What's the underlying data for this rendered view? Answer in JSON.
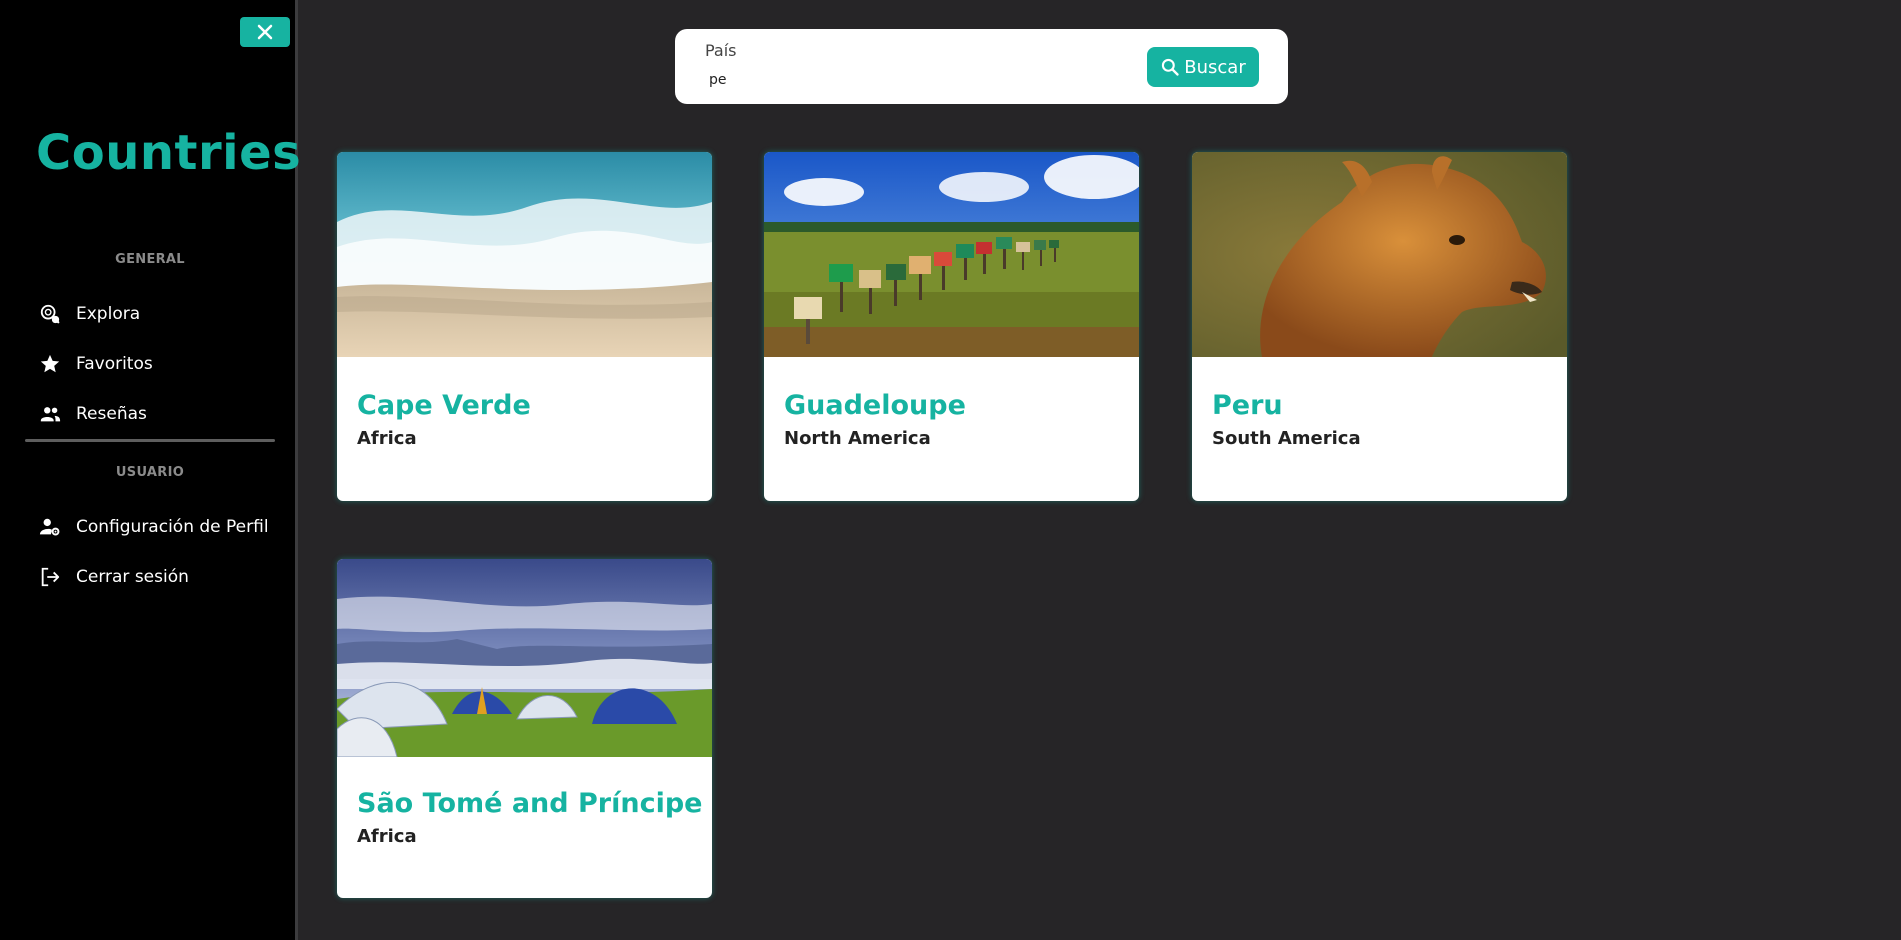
{
  "sidebar": {
    "close_icon": "close-icon",
    "brand": "Countries",
    "general_label": "GENERAL",
    "user_label": "USUARIO",
    "general_items": [
      {
        "label": "Explora",
        "icon": "explore-icon"
      },
      {
        "label": "Favoritos",
        "icon": "star-icon"
      },
      {
        "label": "Reseñas",
        "icon": "people-icon"
      }
    ],
    "user_items": [
      {
        "label": "Configuración de Perfil",
        "icon": "user-settings-icon"
      },
      {
        "label": "Cerrar sesión",
        "icon": "logout-icon"
      }
    ]
  },
  "search": {
    "label": "País",
    "value": "pe",
    "button_label": "Buscar",
    "button_icon": "search-icon"
  },
  "cards": [
    {
      "name": "Cape Verde",
      "continent": "Africa",
      "image": "beach-waves-photo"
    },
    {
      "name": "Guadeloupe",
      "continent": "North America",
      "image": "mailboxes-field-photo"
    },
    {
      "name": "Peru",
      "continent": "South America",
      "image": "alpaca-photo"
    },
    {
      "name": "São Tomé and Príncipe",
      "continent": "Africa",
      "image": "tents-mountain-photo"
    }
  ],
  "colors": {
    "accent": "#16b3a1",
    "background": "#262527",
    "sidebar": "#000000"
  }
}
